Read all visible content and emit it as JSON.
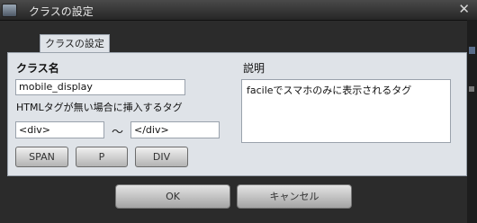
{
  "window": {
    "title": "クラスの設定",
    "close_glyph": "✕"
  },
  "tab": {
    "label": "クラスの設定"
  },
  "class_name": {
    "label": "クラス名",
    "value": "mobile_display"
  },
  "tag": {
    "label": "HTMLタグが無い場合に挿入するタグ",
    "open_value": "<div>",
    "separator": "〜",
    "close_value": "</div>"
  },
  "tag_buttons": [
    "SPAN",
    "P",
    "DIV"
  ],
  "description": {
    "label": "説明",
    "value": "facileでスマホのみに表示されるタグ"
  },
  "dialog_buttons": {
    "ok": "OK",
    "cancel": "キャンセル"
  }
}
